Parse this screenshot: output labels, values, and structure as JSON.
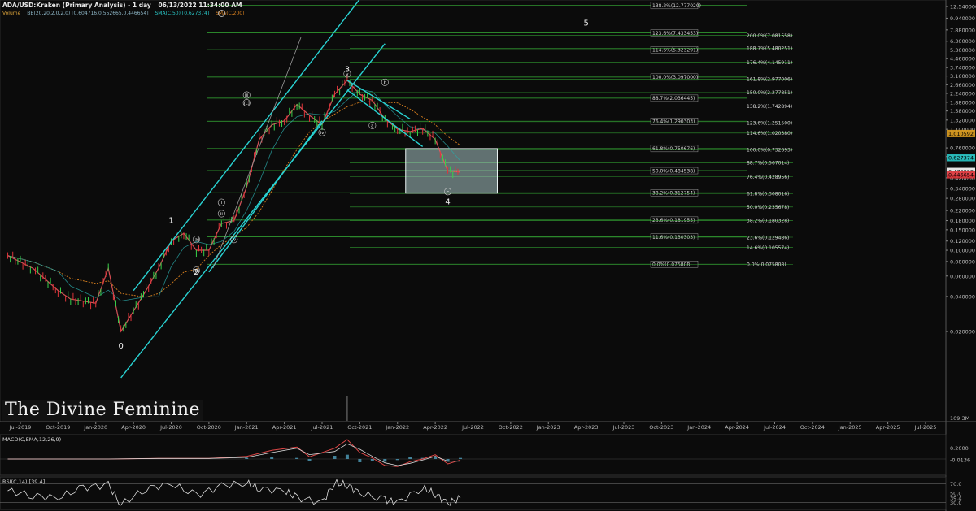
{
  "header": {
    "title": "ADA/USD:Kraken (Primary Analysis) - 1 day",
    "timestamp": "06/13/2022 11:34:00 AM",
    "volume_label": "Volume",
    "bb_label": "BB(20,20,2,0,2,0) [0.604716,0.552665,0.446654]",
    "sma50_label": "SMA(C,50) [0.627374]",
    "sma200_label": "SMA(C,200)"
  },
  "watermark": "The Divine Feminine",
  "colors": {
    "background": "#0b0b0b",
    "channel": "#29d3d3",
    "fib": "#36b136",
    "box_fill": "#b7d7d7",
    "bull": "#37d14a",
    "bear": "#e0343a",
    "sma200": "#d9801f",
    "sma50": "#2aa9a9",
    "macd": "#e04848",
    "macd_signal": "#d8d8d8",
    "macd_hist": "#5ab5d6",
    "rsi": "#dcdcdc"
  },
  "chart_data": {
    "type": "line",
    "scale": "log",
    "symbol": "ADA/USD",
    "x_ticks": [
      "Jul-2019",
      "Oct-2019",
      "Jan-2020",
      "Apr-2020",
      "Jul-2020",
      "Oct-2020",
      "Jan-2021",
      "Apr-2021",
      "Jul-2021",
      "Oct-2021",
      "Jan-2022",
      "Apr-2022",
      "Jul-2022",
      "Oct-2022",
      "Jan-2023",
      "Apr-2023",
      "Jul-2023",
      "Oct-2023",
      "Jan-2024",
      "Apr-2024",
      "Jul-2024",
      "Oct-2024",
      "Jan-2025",
      "Apr-2025",
      "Jul-2025"
    ],
    "y_ticks": [
      "12.540000",
      "9.940000",
      "7.880000",
      "6.300000",
      "5.300000",
      "4.460000",
      "3.740000",
      "3.160000",
      "2.660000",
      "2.240000",
      "1.880000",
      "1.580000",
      "1.320000",
      "1.100000",
      "0.760000",
      "0.640000",
      "0.420000",
      "0.340000",
      "0.280000",
      "0.220000",
      "0.180000",
      "0.150000",
      "0.120000",
      "0.100000",
      "0.080000",
      "0.060000",
      "0.040000",
      "0.020000"
    ],
    "y_tick_values": [
      12.54,
      9.94,
      7.88,
      6.3,
      5.3,
      4.46,
      3.74,
      3.16,
      2.66,
      2.24,
      1.88,
      1.58,
      1.32,
      1.1,
      0.76,
      0.64,
      0.42,
      0.34,
      0.28,
      0.22,
      0.18,
      0.15,
      0.12,
      0.1,
      0.08,
      0.06,
      0.04,
      0.02
    ],
    "ylim": [
      0.012,
      15
    ],
    "price_badges": [
      {
        "text": "1.010592",
        "value": 1.010592,
        "color": "#e0a020"
      },
      {
        "text": "0.627374",
        "value": 0.627374,
        "color": "#29c6c6"
      },
      {
        "text": "0.476898",
        "value": 0.476898,
        "color": "#ffffff"
      },
      {
        "text": "0.446654",
        "value": 0.446654,
        "color": "#e0343a"
      }
    ],
    "volume_axis_label": "109.3M",
    "price": {
      "dates": [
        "2019-06",
        "2019-08",
        "2019-10",
        "2019-11",
        "2020-01",
        "2020-02",
        "2020-03",
        "2020-05",
        "2020-06",
        "2020-07",
        "2020-08",
        "2020-09",
        "2020-10",
        "2020-11",
        "2020-12",
        "2021-01",
        "2021-02",
        "2021-03",
        "2021-04",
        "2021-05",
        "2021-06",
        "2021-07",
        "2021-08",
        "2021-09",
        "2021-10",
        "2021-11",
        "2021-12",
        "2022-01",
        "2022-02",
        "2022-03",
        "2022-04",
        "2022-05",
        "2022-06"
      ],
      "values": [
        0.09,
        0.07,
        0.045,
        0.038,
        0.035,
        0.07,
        0.02,
        0.045,
        0.07,
        0.12,
        0.14,
        0.1,
        0.1,
        0.17,
        0.18,
        0.35,
        0.9,
        1.2,
        1.3,
        1.8,
        1.45,
        1.2,
        2.2,
        2.9,
        2.2,
        1.95,
        1.35,
        1.1,
        1.05,
        1.12,
        0.9,
        0.48,
        0.47
      ]
    },
    "waves": [
      {
        "label": "0",
        "date": "2020-03",
        "value": 0.015
      },
      {
        "label": "1",
        "date": "2020-07",
        "value": 0.18
      },
      {
        "label": "2",
        "date": "2020-09",
        "value": 0.065
      },
      {
        "label": "3",
        "date": "2021-09",
        "value": 3.6
      },
      {
        "label": "4",
        "date": "2022-05",
        "value": 0.26
      },
      {
        "label": "5",
        "date": "2023-04",
        "value": 9.0
      },
      {
        "label": "(a)",
        "date": "2020-09",
        "value": 0.12
      },
      {
        "label": "(b)",
        "date": "2020-09",
        "value": 0.065
      },
      {
        "label": "iii",
        "date": "2021-01",
        "value": 2.1
      },
      {
        "label": "(c)",
        "date": "2021-01",
        "value": 1.8
      },
      {
        "label": "i",
        "date": "2020-11",
        "value": 0.25
      },
      {
        "label": "ii",
        "date": "2020-11",
        "value": 0.2
      },
      {
        "label": "v",
        "date": "2021-09",
        "value": 3.2
      },
      {
        "label": "iv",
        "date": "2021-07",
        "value": 1.0
      },
      {
        "label": "iv",
        "date": "2020-12",
        "value": 0.12
      },
      {
        "label": "a",
        "date": "2021-11",
        "value": 1.15
      },
      {
        "label": "b",
        "date": "2021-12",
        "value": 2.7
      },
      {
        "label": "c",
        "date": "2022-05",
        "value": 0.31
      }
    ],
    "fib_left": [
      {
        "text": "138.2%(12.777020)",
        "value": 12.77702
      },
      {
        "text": "123.6%(7.433453)",
        "value": 7.433453
      },
      {
        "text": "114.6%(5.323291)",
        "value": 5.323291
      },
      {
        "text": "100.0%(3.097000)",
        "value": 3.097
      },
      {
        "text": "88.7%(2.036445)",
        "value": 2.036445
      },
      {
        "text": "76.4%(1.290303)",
        "value": 1.290303
      },
      {
        "text": "61.8%(0.750676)",
        "value": 0.750676
      },
      {
        "text": "50.0%(0.484538)",
        "value": 0.484538
      },
      {
        "text": "38.2%(0.312754)",
        "value": 0.312754
      },
      {
        "text": "23.6%(0.181955)",
        "value": 0.181955
      },
      {
        "text": "11.6%(0.130303)",
        "value": 0.130303
      },
      {
        "text": "0.0%(0.075808)",
        "value": 0.075808
      }
    ],
    "fib_right": [
      {
        "text": "200.0%(7.081558)",
        "value": 7.081558
      },
      {
        "text": "188.7%(5.480251)",
        "value": 5.480251
      },
      {
        "text": "176.4%(4.145911)",
        "value": 4.145911
      },
      {
        "text": "161.8%(2.977006)",
        "value": 2.977006
      },
      {
        "text": "150.0%(2.277851)",
        "value": 2.277851
      },
      {
        "text": "138.2%(1.742894)",
        "value": 1.742894
      },
      {
        "text": "123.6%(1.251500)",
        "value": 1.2515
      },
      {
        "text": "114.6%(1.020380)",
        "value": 1.02038
      },
      {
        "text": "100.0%(0.732693)",
        "value": 0.732693
      },
      {
        "text": "88.7%(0.567014)",
        "value": 0.567014
      },
      {
        "text": "76.4%(0.428956)",
        "value": 0.428956
      },
      {
        "text": "61.8%(0.308016)",
        "value": 0.308016
      },
      {
        "text": "50.0%(0.235678)",
        "value": 0.235678
      },
      {
        "text": "38.2%(0.180328)",
        "value": 0.180328
      },
      {
        "text": "23.6%(0.129486)",
        "value": 0.129486
      },
      {
        "text": "14.6%(0.105574)",
        "value": 0.105574
      },
      {
        "text": "0.0%(0.075808)",
        "value": 0.075808
      }
    ],
    "target_box": {
      "date_start": "2022-01",
      "date_end": "2022-07",
      "high": 0.75,
      "low": 0.31
    },
    "channels": [
      {
        "name": "upper",
        "p1": {
          "date": "2020-04",
          "value": 0.045
        },
        "p2": {
          "date": "2021-10",
          "value": 14.5
        }
      },
      {
        "name": "lower",
        "p1": {
          "date": "2020-03",
          "value": 0.008
        },
        "p2": {
          "date": "2021-12",
          "value": 6.0
        }
      },
      {
        "name": "inner",
        "p1": {
          "date": "2020-10",
          "value": 0.065
        },
        "p2": {
          "date": "2021-07",
          "value": 1.3
        }
      },
      {
        "name": "c-down-upper",
        "p1": {
          "date": "2021-09",
          "value": 2.9
        },
        "p2": {
          "date": "2022-02",
          "value": 1.35
        }
      },
      {
        "name": "c-down-lower",
        "p1": {
          "date": "2021-09",
          "value": 2.4
        },
        "p2": {
          "date": "2022-03",
          "value": 0.78
        }
      }
    ],
    "macd": {
      "label": "MACD(C,EMA,12,26,9)",
      "y_ticks": [
        "0.2000",
        "-0.0136"
      ],
      "ylim": [
        -0.3,
        0.45
      ],
      "dates": [
        "2019-06",
        "2019-10",
        "2020-02",
        "2020-06",
        "2020-10",
        "2021-01",
        "2021-03",
        "2021-05",
        "2021-06",
        "2021-08",
        "2021-09",
        "2021-10",
        "2021-11",
        "2021-12",
        "2022-01",
        "2022-02",
        "2022-03",
        "2022-04",
        "2022-05",
        "2022-06"
      ],
      "values": [
        0,
        0,
        0,
        0.01,
        0.01,
        0.05,
        0.16,
        0.22,
        0.04,
        0.2,
        0.36,
        0.12,
        0.02,
        -0.12,
        -0.14,
        -0.05,
        0.0,
        0.08,
        -0.09,
        -0.02
      ],
      "signal": [
        0,
        0,
        0,
        0.01,
        0.01,
        0.03,
        0.12,
        0.2,
        0.08,
        0.14,
        0.28,
        0.18,
        0.05,
        -0.07,
        -0.12,
        -0.08,
        -0.02,
        0.05,
        -0.04,
        -0.04
      ]
    },
    "rsi": {
      "label": "RSI(C,14) [39.4]",
      "y_ticks": [
        "70.0",
        "50.0",
        "39.4",
        "30.0"
      ],
      "ylim": [
        15,
        85
      ],
      "dates": [
        "2019-06",
        "2019-08",
        "2019-10",
        "2019-12",
        "2020-02",
        "2020-03",
        "2020-05",
        "2020-07",
        "2020-09",
        "2020-11",
        "2021-01",
        "2021-02",
        "2021-04",
        "2021-05",
        "2021-07",
        "2021-08",
        "2021-09",
        "2021-10",
        "2021-12",
        "2022-01",
        "2022-03",
        "2022-04",
        "2022-05",
        "2022-06"
      ],
      "values": [
        55,
        45,
        40,
        62,
        68,
        25,
        60,
        70,
        45,
        66,
        72,
        60,
        55,
        40,
        30,
        72,
        68,
        50,
        35,
        30,
        62,
        48,
        28,
        39.4
      ]
    }
  }
}
